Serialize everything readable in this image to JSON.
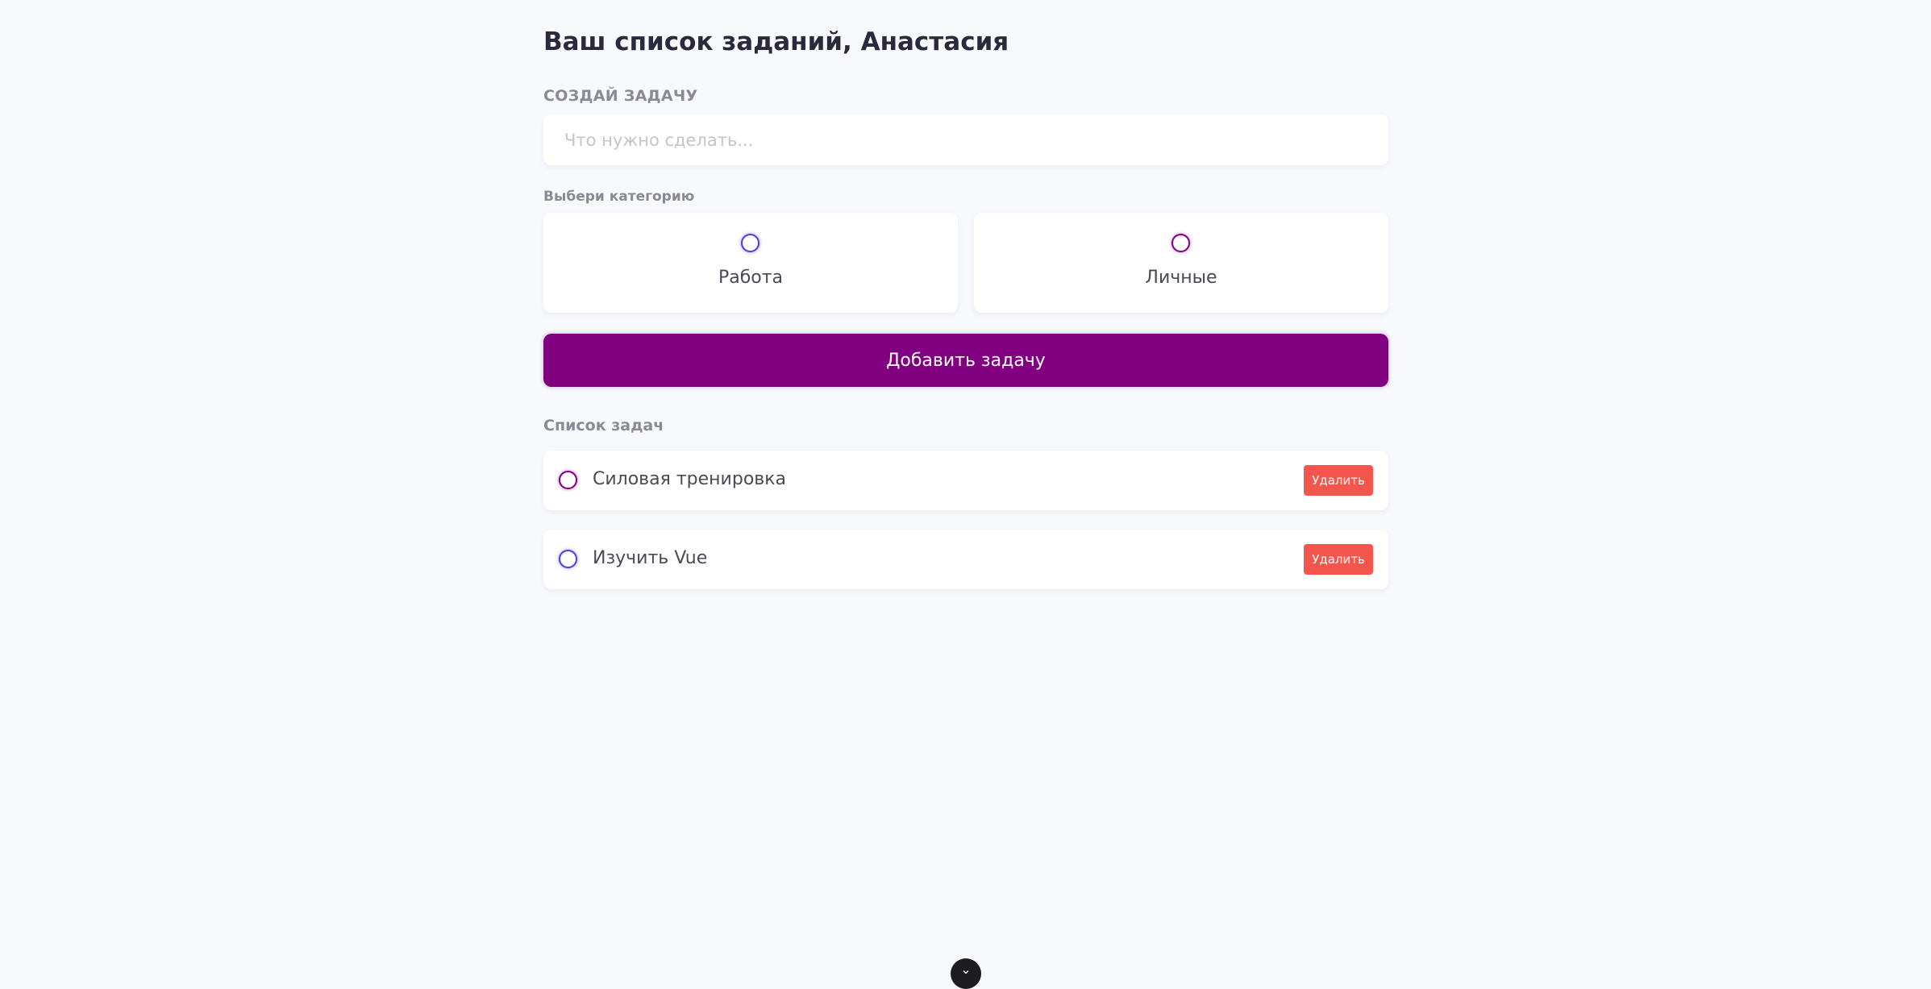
{
  "header": {
    "title": "Ваш список заданий, Анастасия"
  },
  "create": {
    "section_label": "СОЗДАЙ ЗАДАЧУ",
    "input_value": "",
    "input_placeholder": "Что нужно сделать..."
  },
  "category": {
    "section_label": "Выбери категорию",
    "options": [
      {
        "label": "Работа",
        "color": "#4a3ee6",
        "selected": false
      },
      {
        "label": "Личные",
        "color": "#800080",
        "selected": false
      }
    ]
  },
  "add_button": {
    "label": "Добавить задачу",
    "color": "#800080"
  },
  "todo_list": {
    "section_label": "Список задач",
    "items": [
      {
        "text": "Силовая тренировка",
        "category_color": "#800080",
        "done": false,
        "delete_label": "Удалить"
      },
      {
        "text": "Изучить Vue",
        "category_color": "#4a3ee6",
        "done": false,
        "delete_label": "Удалить"
      }
    ]
  },
  "devtools_toggle": {
    "icon": "chevron-down-icon",
    "glyph": "⌄"
  },
  "colors": {
    "background": "#f8f9fd",
    "delete": "#f4564e"
  }
}
